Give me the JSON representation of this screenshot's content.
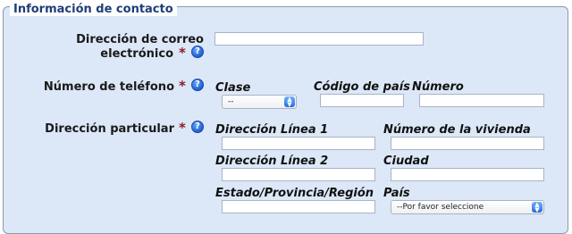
{
  "section": {
    "title": "Información de contacto"
  },
  "required_mark": "*",
  "help_icon_glyph": "?",
  "email": {
    "label_line1": "Dirección de correo",
    "label_line2": "electrónico",
    "value": ""
  },
  "phone": {
    "label": "Número de teléfono",
    "clase_label": "Clase",
    "clase_value": "--",
    "country_code_label": "Código de país",
    "country_code_value": "",
    "number_label": "Número",
    "number_value": ""
  },
  "address": {
    "label": "Dirección particular",
    "line1_label": "Dirección Línea 1",
    "line1_value": "",
    "house_number_label": "Número de la vivienda",
    "house_number_value": "",
    "line2_label": "Dirección Línea 2",
    "line2_value": "",
    "city_label": "Ciudad",
    "city_value": "",
    "state_label": "Estado/Provincia/Región",
    "state_value": "",
    "country_label": "País",
    "country_value": "--Por favor seleccione"
  },
  "colors": {
    "panel_bg": "#dce8f8",
    "legend_text": "#1f3d78",
    "required": "#8b1e1e",
    "help_icon": "#1f5fd0"
  }
}
